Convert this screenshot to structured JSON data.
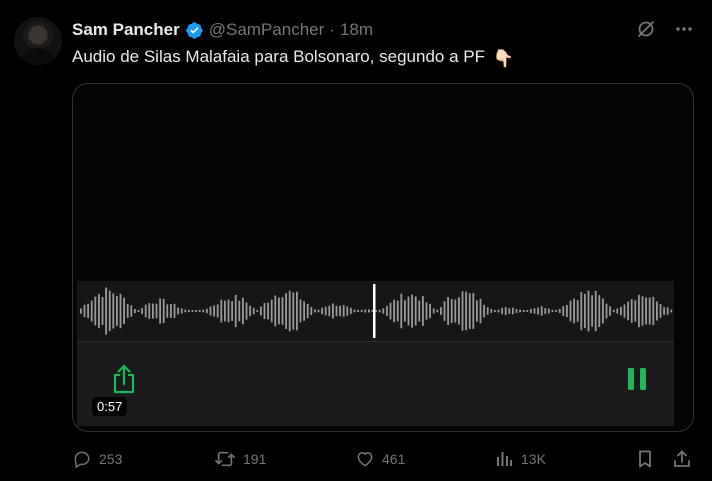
{
  "author": {
    "display_name": "Sam Pancher",
    "handle": "@SamPancher",
    "separator": "·",
    "time": "18m",
    "verified_color": "#1d9bf0"
  },
  "tweet": {
    "text": "Audio de Silas Malafaia para Bolsonaro, segundo a PF",
    "emoji": "👇🏻"
  },
  "media": {
    "type": "audio",
    "duration": "0:57",
    "accent_color": "#1db954",
    "share_icon": "share-icon",
    "pause_icon": "pause-icon"
  },
  "stats": {
    "replies": "253",
    "reposts": "191",
    "likes": "461",
    "views": "13K"
  },
  "icons": {
    "grok": "grok-icon",
    "more": "more-icon",
    "reply": "reply-icon",
    "repost": "repost-icon",
    "like": "heart-icon",
    "views": "views-icon",
    "bookmark": "bookmark-icon",
    "share": "share-icon"
  }
}
